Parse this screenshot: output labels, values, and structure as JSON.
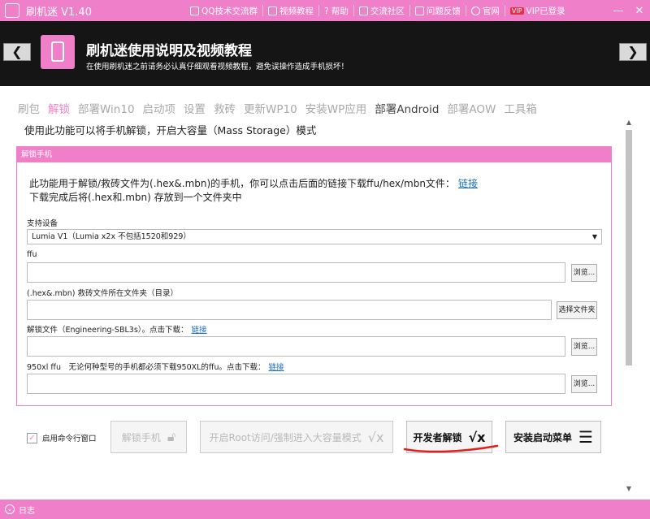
{
  "window": {
    "title": "刷机迷 V1.40",
    "menu": [
      {
        "label": "QQ技术交流群",
        "icon": "qq-icon"
      },
      {
        "label": "视频教程",
        "icon": "video-icon"
      },
      {
        "label": "帮助",
        "icon": "help-icon"
      },
      {
        "label": "交流社区",
        "icon": "chat-icon"
      },
      {
        "label": "问题反馈",
        "icon": "feedback-icon"
      },
      {
        "label": "官网",
        "icon": "globe-icon"
      },
      {
        "label": "VIP已登录",
        "icon": "vip-icon",
        "tag": "VIP"
      }
    ]
  },
  "banner": {
    "title": "刷机迷使用说明及视频教程",
    "subtitle": "在使用刷机迷之前请务必认真仔细观看视频教程，避免误操作造成手机损坏！"
  },
  "tabs": [
    {
      "label": "刷包",
      "state": "normal"
    },
    {
      "label": "解锁",
      "state": "active"
    },
    {
      "label": "部署Win10",
      "state": "normal"
    },
    {
      "label": "启动项",
      "state": "normal"
    },
    {
      "label": "设置",
      "state": "normal"
    },
    {
      "label": "救砖",
      "state": "normal"
    },
    {
      "label": "更新WP10",
      "state": "normal"
    },
    {
      "label": "安装WP应用",
      "state": "normal"
    },
    {
      "label": "部署Android",
      "state": "dark"
    },
    {
      "label": "部署AOW",
      "state": "normal"
    },
    {
      "label": "工具箱",
      "state": "normal"
    }
  ],
  "description": "使用此功能可以将手机解锁，开启大容量（Mass Storage）模式",
  "group": {
    "header": "解锁手机",
    "info_line1": "此功能用于解锁/救砖文件为(.hex&.mbn)的手机，你可以点击后面的链接下载ffu/hex/mbn文件：",
    "info_link": "链接",
    "info_line2": "下载完成后将(.hex和.mbn) 存放到一个文件夹中",
    "device_label": "支持设备",
    "device_value": "Lumia V1（Lumia x2x 不包括1520和929）",
    "ffu_label": "ffu",
    "ffu_value": "",
    "browse1": "浏览...",
    "folder_label": "(.hex&.mbn) 救砖文件所在文件夹（目录）",
    "folder_value": "",
    "choose_folder": "选择文件夹",
    "unlockfile_label": "解锁文件（Engineering-SBL3s）。点击下载：",
    "unlockfile_link": "链接",
    "unlockfile_value": "",
    "browse2": "浏览...",
    "ffu950_label": "950xl ffu　无论何种型号的手机都必须下载950XL的ffu。点击下载：",
    "ffu950_link": "链接",
    "ffu950_value": "",
    "browse3": "浏览..."
  },
  "bottom": {
    "cmd_checkbox": "启用命令行窗口",
    "cmd_checked": true,
    "unlock_btn": "解锁手机",
    "root_btn": "开启Root访问/强制进入大容量模式",
    "dev_unlock_btn": "开发者解锁",
    "boot_menu_btn": "安装启动菜单"
  },
  "status": {
    "log_label": "日志"
  },
  "colors": {
    "accent": "#ef7fc8",
    "banner_bg": "#151515",
    "link": "#1d6fb8",
    "annotation": "#e02020"
  }
}
